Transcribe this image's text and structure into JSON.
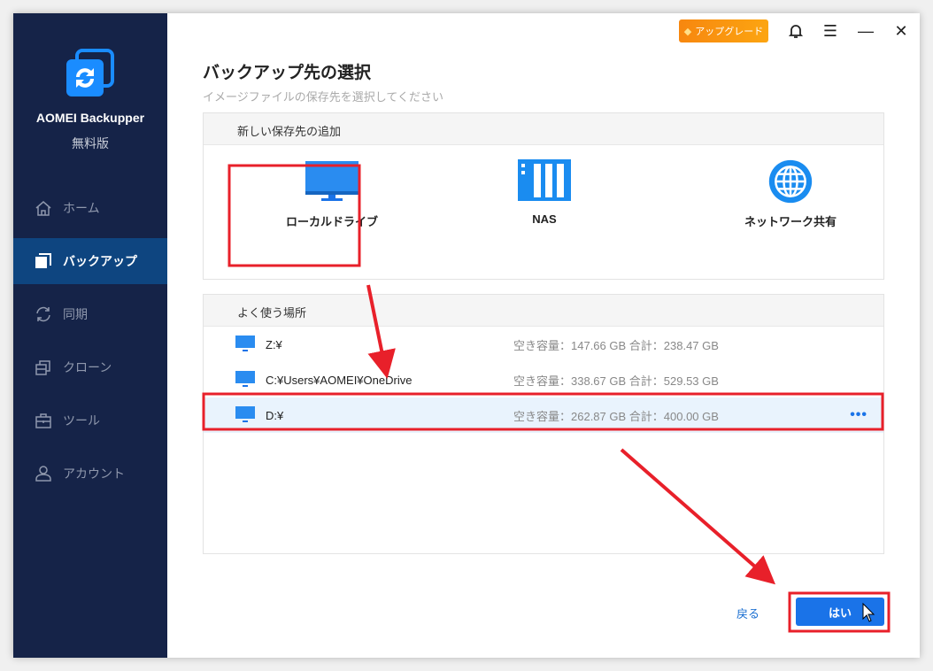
{
  "app": {
    "name": "AOMEI Backupper",
    "edition": "無料版"
  },
  "sidebar": {
    "items": [
      {
        "label": "ホーム"
      },
      {
        "label": "バックアップ"
      },
      {
        "label": "同期"
      },
      {
        "label": "クローン"
      },
      {
        "label": "ツール"
      },
      {
        "label": "アカウント"
      }
    ]
  },
  "titlebar": {
    "upgrade": "アップグレード"
  },
  "page": {
    "title": "バックアップ先の選択",
    "subtitle": "イメージファイルの保存先を選択してください"
  },
  "new_dest": {
    "header": "新しい保存先の追加",
    "options": [
      {
        "label": "ローカルドライブ"
      },
      {
        "label": "NAS"
      },
      {
        "label": "ネットワーク共有"
      }
    ]
  },
  "recent": {
    "header": "よく使う場所",
    "items": [
      {
        "name": "Z:¥",
        "capacity": "空き容量：147.66 GB 合計：238.47 GB"
      },
      {
        "name": "C:¥Users¥AOMEI¥OneDrive",
        "capacity": "空き容量：338.67 GB 合計：529.53 GB"
      },
      {
        "name": "D:¥",
        "capacity": "空き容量：262.87 GB 合計：400.00 GB"
      }
    ]
  },
  "footer": {
    "back": "戻る",
    "ok": "はい"
  },
  "colors": {
    "sidebar": "#152348",
    "accent": "#1a73e8",
    "annotation": "#e8202a"
  }
}
